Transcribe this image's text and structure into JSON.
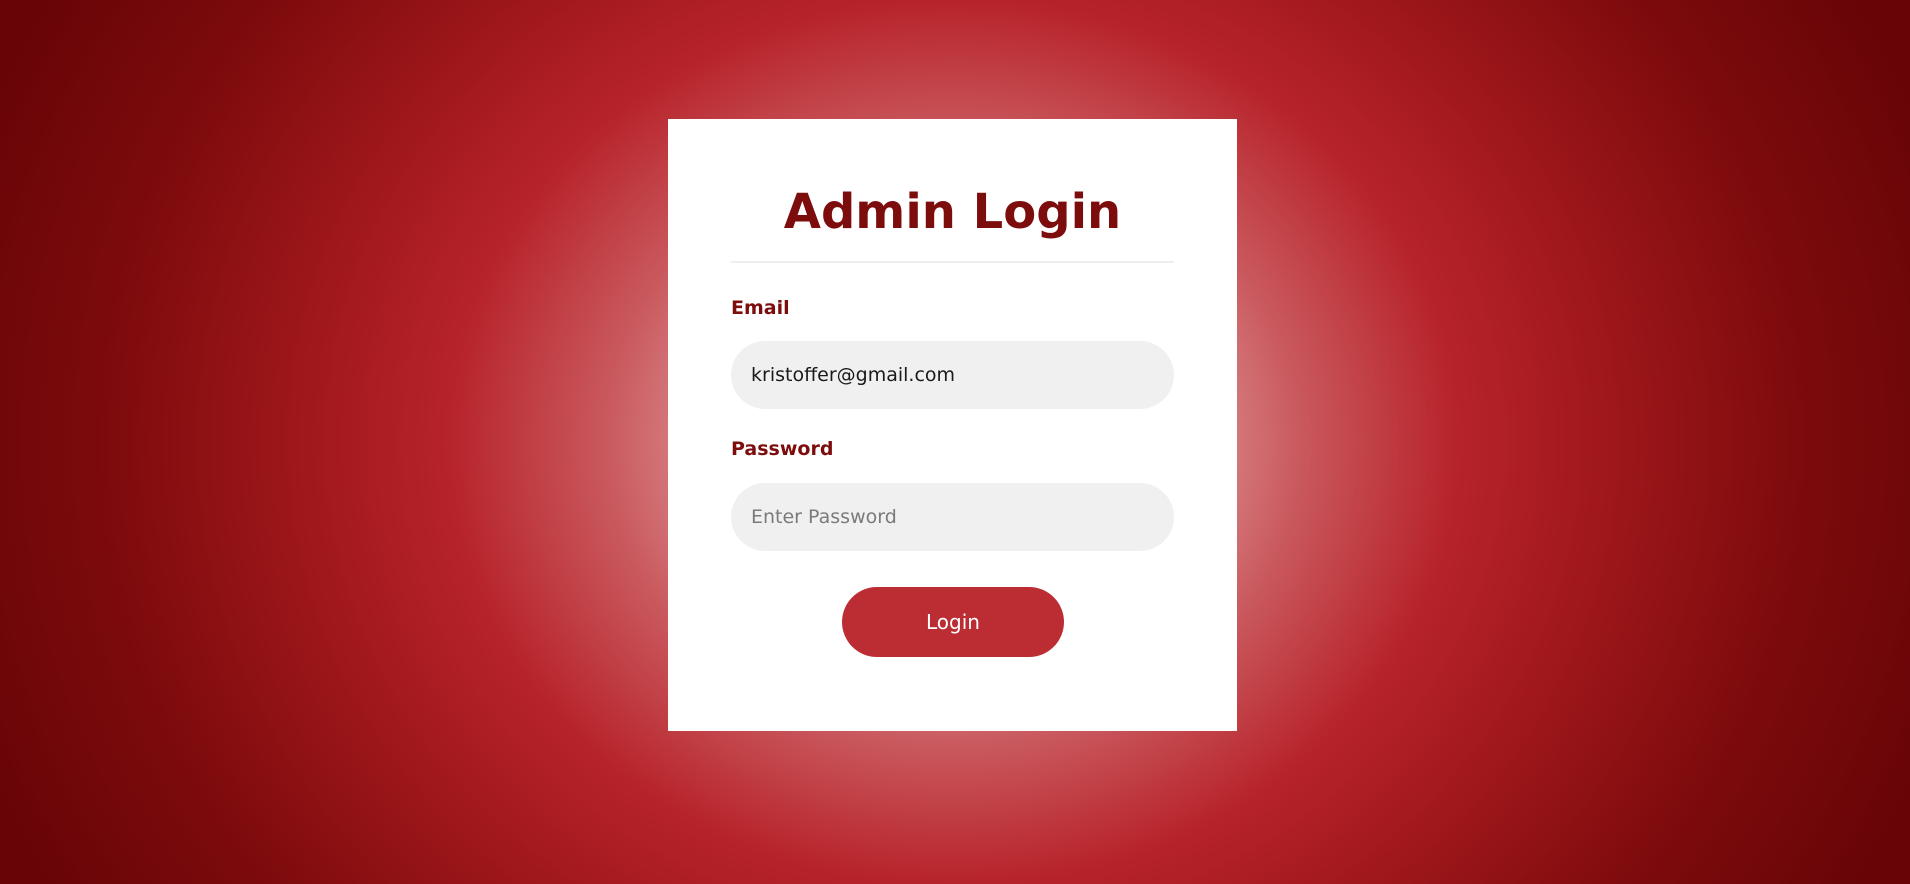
{
  "colors": {
    "accent": "#7d0c0c",
    "button": "#bb2d33",
    "input_bg": "#f0f0f0"
  },
  "login": {
    "title": "Admin Login",
    "email_label": "Email",
    "email_value": "kristoffer@gmail.com",
    "email_placeholder": "",
    "password_label": "Password",
    "password_value": "",
    "password_placeholder": "Enter Password",
    "submit_label": "Login"
  }
}
